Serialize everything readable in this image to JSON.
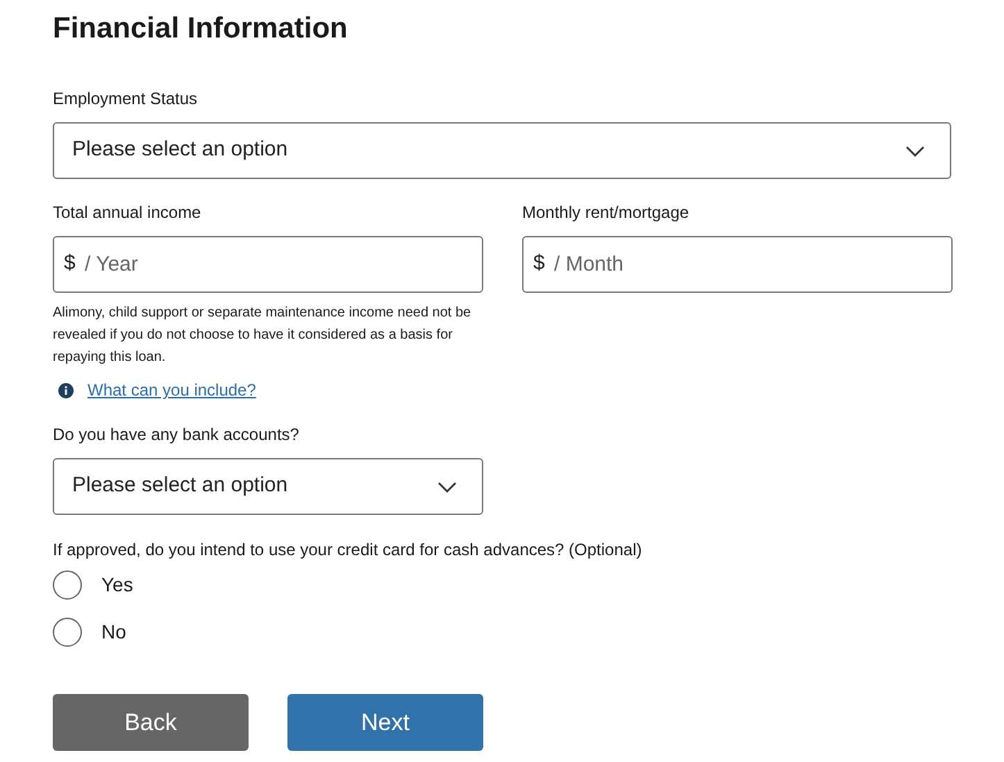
{
  "title": "Financial Information",
  "employment": {
    "label": "Employment Status",
    "value": "Please select an option"
  },
  "income": [
    {
      "label": "Total annual income",
      "prefix": "$",
      "placeholder": "/ Year"
    },
    {
      "label": "Monthly rent/mortgage",
      "prefix": "$",
      "placeholder": "/ Month"
    }
  ],
  "income_note": "Alimony, child support or separate maintenance income need not be revealed if you do not choose to have it considered as a basis for repaying this loan.",
  "info_link": "What can you include?",
  "bank": {
    "label": "Do you have any bank accounts?",
    "value": "Please select an option"
  },
  "cash_advance": {
    "question": "If approved, do you intend to use your credit card for cash advances? (Optional)",
    "options": [
      {
        "label": "Yes",
        "selected": false
      },
      {
        "label": "No",
        "selected": false
      }
    ]
  },
  "buttons": [
    {
      "label": "Back",
      "kind": "secondary"
    },
    {
      "label": "Next",
      "kind": "primary"
    }
  ]
}
